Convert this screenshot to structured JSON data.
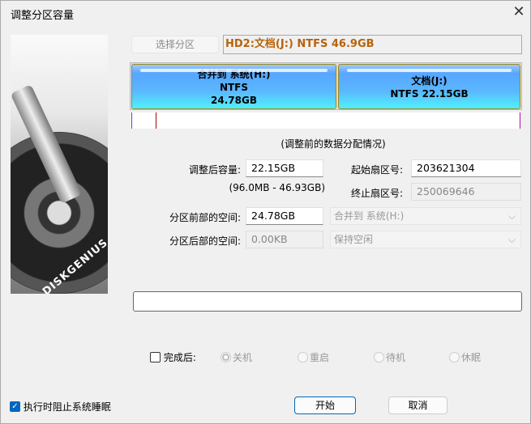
{
  "window": {
    "title": "调整分区容量",
    "close_icon": "close-icon"
  },
  "header": {
    "select_partition_label": "选择分区",
    "partition_info": "HD2:文档(J:) NTFS 46.9GB",
    "info_color": "#b8620a"
  },
  "partition_map": {
    "partitions": [
      {
        "line1": "合并到 系统(H:)",
        "line2": "NTFS",
        "line3": "24.78GB"
      },
      {
        "line1": "文档(J:)",
        "line2": "NTFS 22.15GB"
      }
    ],
    "caption": "(调整前的数据分配情况)"
  },
  "form": {
    "new_size_label": "调整后容量:",
    "new_size_value": "22.15GB",
    "size_range": "(96.0MB - 46.93GB)",
    "start_sector_label": "起始扇区号:",
    "start_sector_value": "203621304",
    "end_sector_label": "终止扇区号:",
    "end_sector_value": "250069646",
    "front_space_label": "分区前部的空间:",
    "front_space_value": "24.78GB",
    "front_space_action": "合并到 系统(H:)",
    "back_space_label": "分区后部的空间:",
    "back_space_value": "0.00KB",
    "back_space_action": "保持空闲"
  },
  "completion": {
    "label": "完成后:",
    "checked": false,
    "options": [
      "关机",
      "重启",
      "待机",
      "休眠"
    ],
    "selected": "关机"
  },
  "footer": {
    "prevent_sleep_label": "执行时阻止系统睡眠",
    "prevent_sleep_checked": true,
    "start_label": "开始",
    "cancel_label": "取消"
  }
}
